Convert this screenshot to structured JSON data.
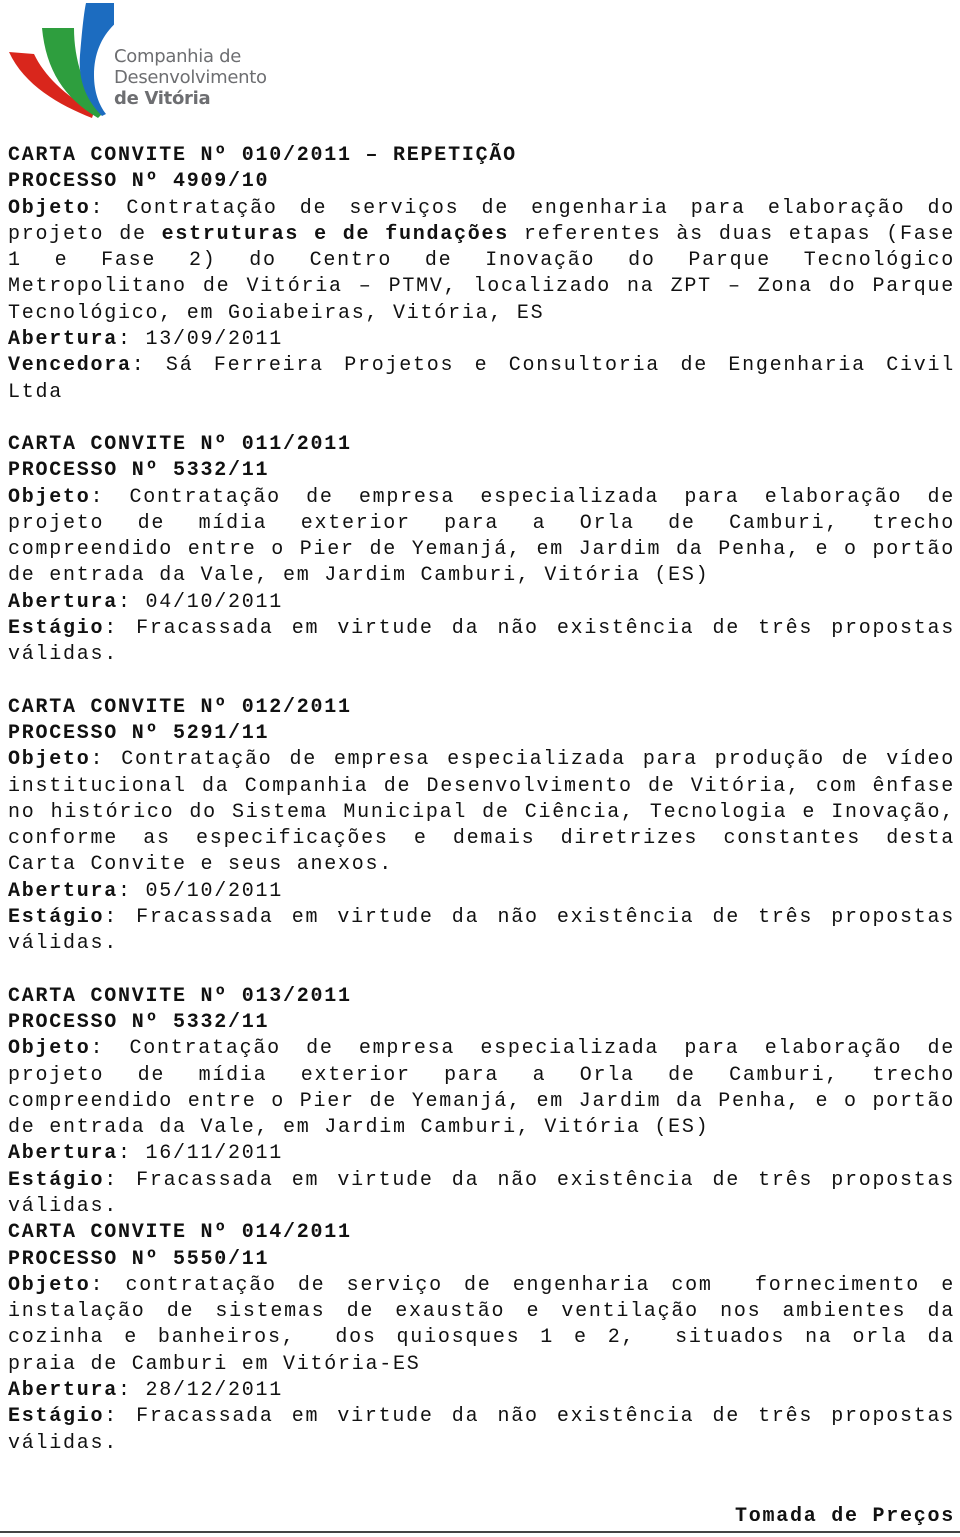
{
  "logo": {
    "line1": "Companhia de",
    "line2": "Desenvolvimento",
    "line3": "de Vitória",
    "colors": {
      "red": "#d9261c",
      "green": "#2e9e3e",
      "blue": "#1c6cc0",
      "text": "#6d6e71"
    }
  },
  "labels": {
    "objeto": "Objeto",
    "abertura": "Abertura",
    "vencedora": "Vencedora",
    "estagio": "Estágio",
    "colon": ":"
  },
  "entries": [
    {
      "title": "CARTA CONVITE Nº 010/2011 – REPETIÇÃO",
      "processo": "PROCESSO Nº 4909/10",
      "objeto_pre": " Contratação de serviços de engenharia para elaboração do projeto de ",
      "objeto_bold": "estruturas e de fundações",
      "objeto_post": " referentes às duas etapas (Fase 1 e Fase 2) do Centro de Inovação do Parque Tecnológico Metropolitano de Vitória – PTMV, localizado na ZPT – Zona do Parque Tecnológico, em Goiabeiras, Vitória, ES",
      "abertura": " 13/09/2011",
      "vencedora": " Sá Ferreira Projetos e Consultoria de Engenharia Civil Ltda"
    },
    {
      "title": "CARTA CONVITE Nº 011/2011",
      "processo": "PROCESSO Nº 5332/11",
      "objeto": " Contratação de empresa especializada para elaboração de projeto de mídia exterior para a Orla de Camburi, trecho compreendido entre o Pier de Yemanjá, em Jardim da Penha, e o portão de entrada da Vale, em Jardim Camburi, Vitória (ES)",
      "abertura": " 04/10/2011",
      "estagio": " Fracassada em virtude da não existência de três propostas válidas."
    },
    {
      "title": "CARTA CONVITE Nº 012/2011",
      "processo": "PROCESSO Nº 5291/11",
      "objeto": " Contratação de empresa especializada para produção de vídeo institucional da Companhia de Desenvolvimento de Vitória, com ênfase no histórico do Sistema Municipal de Ciência, Tecnologia e Inovação, conforme as especificações e demais diretrizes constantes desta Carta Convite e seus anexos.",
      "abertura": " 05/10/2011",
      "estagio": " Fracassada em virtude da não existência de três propostas válidas."
    },
    {
      "title": "CARTA CONVITE Nº 013/2011",
      "processo": "PROCESSO Nº 5332/11",
      "objeto": " Contratação de empresa especializada para elaboração de projeto de mídia exterior para a Orla de Camburi, trecho compreendido entre o Pier de Yemanjá, em Jardim da Penha, e o portão de entrada da Vale, em Jardim Camburi, Vitória (ES)",
      "abertura": " 16/11/2011",
      "estagio": " Fracassada em virtude da não existência de três propostas válidas."
    },
    {
      "title": "CARTA CONVITE Nº 014/2011",
      "processo": "PROCESSO Nº 5550/11",
      "objeto": " contratação de serviço de engenharia com  fornecimento e instalação de sistemas de exaustão e ventilação nos ambientes da cozinha e banheiros,  dos quiosques 1 e 2,  situados na orla da praia de Camburi em Vitória-ES",
      "abertura": " 28/12/2011",
      "estagio": " Fracassada em virtude da não existência de três propostas válidas."
    }
  ],
  "footer": {
    "section_title": "Tomada de Preços"
  }
}
